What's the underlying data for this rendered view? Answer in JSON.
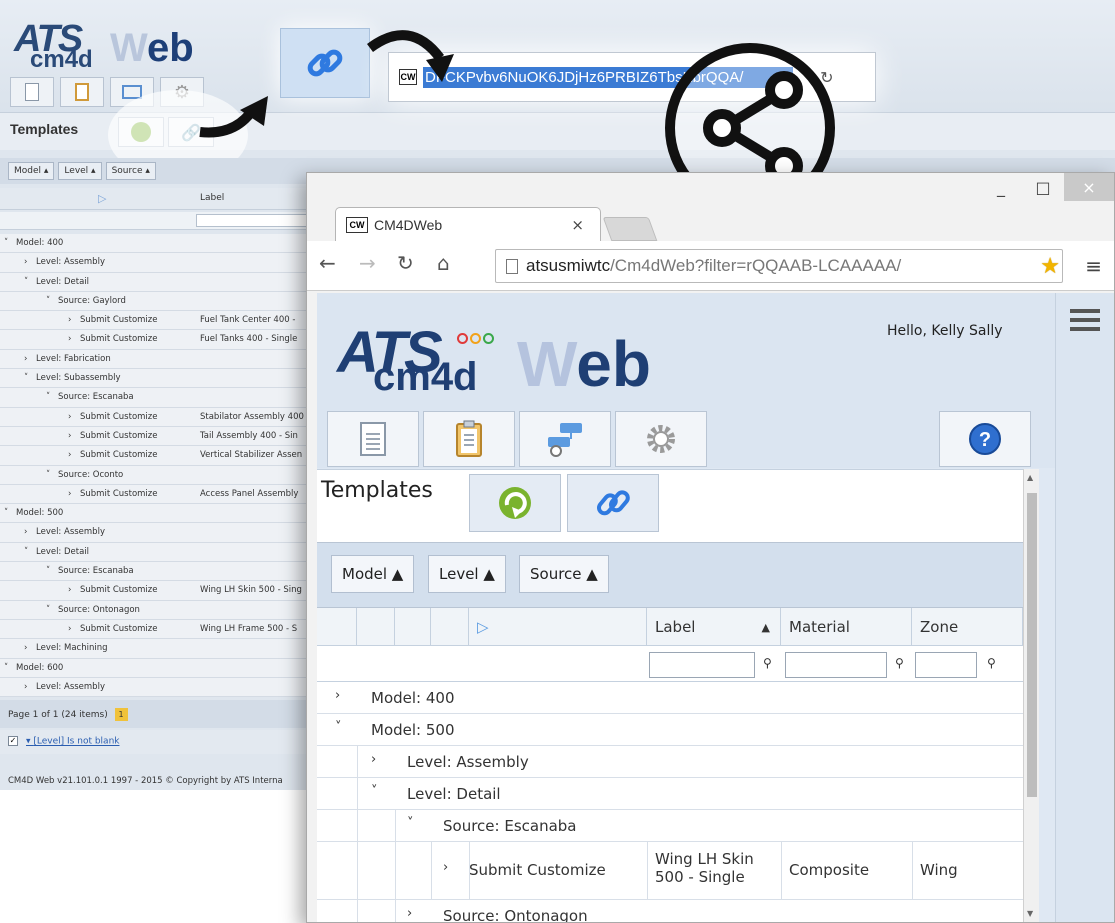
{
  "background_app": {
    "logo_ats": "ATS",
    "logo_cm4d": "cm4d",
    "logo_web_w": "W",
    "logo_web_rest": "eb",
    "templates_label": "Templates",
    "filter_chips": [
      "Model",
      "Level",
      "Source"
    ],
    "label_column": "Label",
    "rows": [
      {
        "indent": 16,
        "arrow": "˅",
        "text": "Model: 400",
        "label": ""
      },
      {
        "indent": 36,
        "arrow": "›",
        "text": "Level: Assembly",
        "label": ""
      },
      {
        "indent": 36,
        "arrow": "˅",
        "text": "Level: Detail",
        "label": ""
      },
      {
        "indent": 58,
        "arrow": "˅",
        "text": "Source: Gaylord",
        "label": ""
      },
      {
        "indent": 80,
        "arrow": "›",
        "text": "Submit Customize",
        "label": "Fuel Tank Center 400 -"
      },
      {
        "indent": 80,
        "arrow": "›",
        "text": "Submit Customize",
        "label": "Fuel Tanks 400 - Single"
      },
      {
        "indent": 36,
        "arrow": "›",
        "text": "Level: Fabrication",
        "label": ""
      },
      {
        "indent": 36,
        "arrow": "˅",
        "text": "Level: Subassembly",
        "label": ""
      },
      {
        "indent": 58,
        "arrow": "˅",
        "text": "Source: Escanaba",
        "label": ""
      },
      {
        "indent": 80,
        "arrow": "›",
        "text": "Submit Customize",
        "label": "Stabilator Assembly 400"
      },
      {
        "indent": 80,
        "arrow": "›",
        "text": "Submit Customize",
        "label": "Tail Assembly 400 - Sin"
      },
      {
        "indent": 80,
        "arrow": "›",
        "text": "Submit Customize",
        "label": "Vertical Stabilizer Assen"
      },
      {
        "indent": 58,
        "arrow": "˅",
        "text": "Source: Oconto",
        "label": ""
      },
      {
        "indent": 80,
        "arrow": "›",
        "text": "Submit Customize",
        "label": "Access Panel Assembly"
      },
      {
        "indent": 16,
        "arrow": "˅",
        "text": "Model: 500",
        "label": ""
      },
      {
        "indent": 36,
        "arrow": "›",
        "text": "Level: Assembly",
        "label": ""
      },
      {
        "indent": 36,
        "arrow": "˅",
        "text": "Level: Detail",
        "label": ""
      },
      {
        "indent": 58,
        "arrow": "˅",
        "text": "Source: Escanaba",
        "label": ""
      },
      {
        "indent": 80,
        "arrow": "›",
        "text": "Submit Customize",
        "label": "Wing LH Skin 500 - Sing"
      },
      {
        "indent": 58,
        "arrow": "˅",
        "text": "Source: Ontonagon",
        "label": ""
      },
      {
        "indent": 80,
        "arrow": "›",
        "text": "Submit Customize",
        "label": "Wing LH Frame 500 - S"
      },
      {
        "indent": 36,
        "arrow": "›",
        "text": "Level: Machining",
        "label": ""
      },
      {
        "indent": 16,
        "arrow": "˅",
        "text": "Model: 600",
        "label": ""
      },
      {
        "indent": 36,
        "arrow": "›",
        "text": "Level: Assembly",
        "label": ""
      }
    ],
    "pager_text": "Page 1 of 1 (24 items)",
    "pager_page": "1",
    "condition_text": "[Level] Is not blank",
    "footer_text": "CM4D Web v21.101.0.1 1997 - 2015 © Copyright by ATS Interna",
    "highlighted_url": "DFCKPvbv6NuOK6JDjHz6PRBIZ6TbsKbrQQA/",
    "favicon_text": "CW"
  },
  "browser": {
    "tab_favicon": "CW",
    "tab_title": "CM4DWeb",
    "tab_close": "×",
    "url_host": "atsusmiwtc",
    "url_path": "/Cm4dWeb?filter=rQQAAB-LCAAAAA/",
    "min_label": "_",
    "max_label": "□",
    "close_label": "×"
  },
  "app": {
    "logo_ats": "ATS",
    "logo_cm4d": "cm4d",
    "logo_web_w": "W",
    "logo_web_rest": "eb",
    "greeting": "Hello, Kelly Sally",
    "templates_title": "Templates",
    "group_chips": [
      "Model ▲",
      "Level ▲",
      "Source ▲"
    ],
    "columns": {
      "label": "Label",
      "label_sort": "▲",
      "material": "Material",
      "zone": "Zone"
    },
    "rows": [
      {
        "indent": 14,
        "arrow": "›",
        "text": "Model: 400",
        "type": "group"
      },
      {
        "indent": 14,
        "arrow": "˅",
        "text": "Model: 500",
        "type": "group"
      },
      {
        "indent": 50,
        "arrow": "›",
        "text": "Level: Assembly",
        "type": "group"
      },
      {
        "indent": 50,
        "arrow": "˅",
        "text": "Level: Detail",
        "type": "group"
      },
      {
        "indent": 86,
        "arrow": "˅",
        "text": "Source: Escanaba",
        "type": "group"
      },
      {
        "indent": 122,
        "arrow": "›",
        "text": "Submit Customize",
        "type": "data",
        "label": "Wing LH Skin 500 - Single",
        "material": "Composite",
        "zone": "Wing"
      },
      {
        "indent": 86,
        "arrow": "›",
        "text": "Source: Ontonagon",
        "type": "group"
      }
    ]
  },
  "colors": {
    "accent_blue": "#3b7bd4",
    "logo_navy": "#1f3f74",
    "logo_light": "#b5c3de",
    "header_bg": "#dbe5f1",
    "star_gold": "#f2b400"
  },
  "icons": [
    "document-icon",
    "clipboard-icon",
    "network-icon",
    "gear-icon",
    "help-icon",
    "refresh-icon",
    "link-icon",
    "share-icon",
    "star-icon",
    "hamburger-icon"
  ]
}
